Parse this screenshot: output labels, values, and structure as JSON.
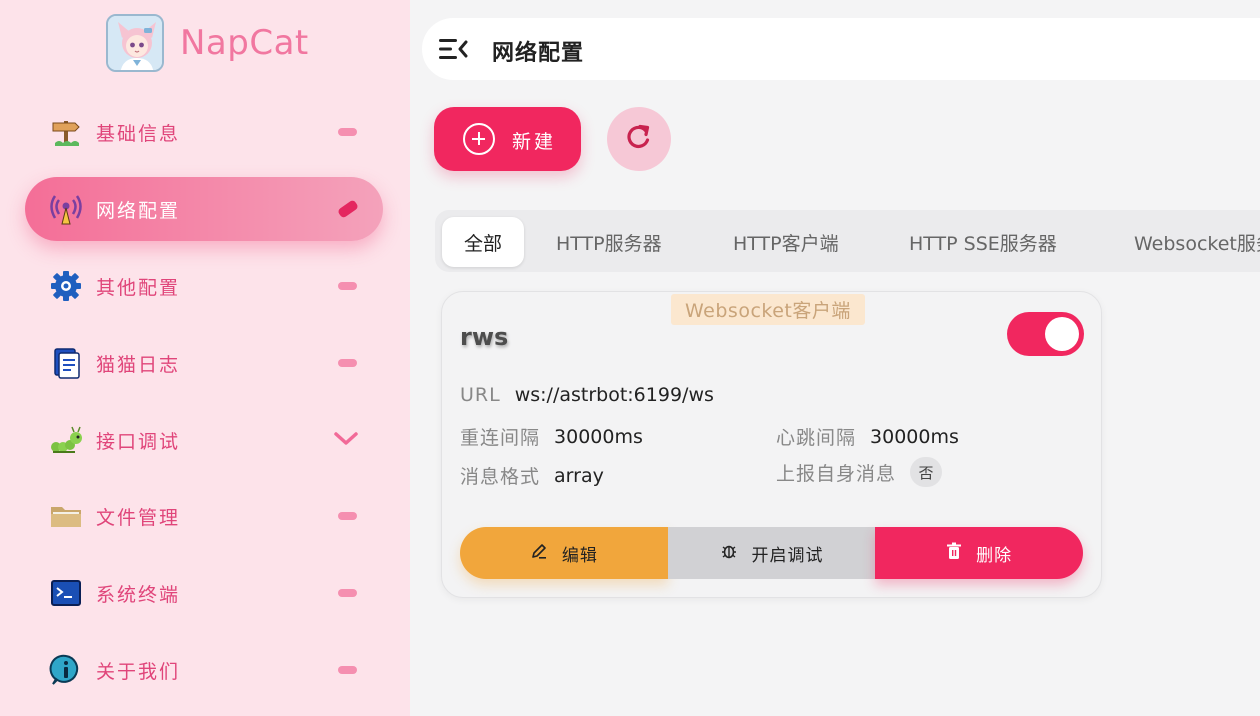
{
  "app": {
    "name": "NapCat"
  },
  "header": {
    "title": "网络配置"
  },
  "sidebar": {
    "items": [
      {
        "label": "基础信息",
        "icon": "signpost-icon",
        "active": false
      },
      {
        "label": "网络配置",
        "icon": "antenna-icon",
        "active": true
      },
      {
        "label": "其他配置",
        "icon": "gear-icon",
        "active": false
      },
      {
        "label": "猫猫日志",
        "icon": "document-icon",
        "active": false
      },
      {
        "label": "接口调试",
        "icon": "caterpillar-icon",
        "active": false,
        "expandable": true
      },
      {
        "label": "文件管理",
        "icon": "folder-icon",
        "active": false
      },
      {
        "label": "系统终端",
        "icon": "terminal-icon",
        "active": false
      },
      {
        "label": "关于我们",
        "icon": "info-icon",
        "active": false
      }
    ]
  },
  "toolbar": {
    "new_label": "新建",
    "refresh_icon": "refresh-icon"
  },
  "tabs": [
    {
      "label": "全部",
      "active": true
    },
    {
      "label": "HTTP服务器"
    },
    {
      "label": "HTTP客户端"
    },
    {
      "label": "HTTP SSE服务器"
    },
    {
      "label": "Websocket服务器"
    }
  ],
  "card": {
    "type": "Websocket客户端",
    "name": "rws",
    "enabled": true,
    "url_label": "URL",
    "url_value": "ws://astrbot:6199/ws",
    "reconnect_label": "重连间隔",
    "reconnect_value": "30000ms",
    "heartbeat_label": "心跳间隔",
    "heartbeat_value": "30000ms",
    "format_label": "消息格式",
    "format_value": "array",
    "report_self_label": "上报自身消息",
    "report_self_value": "否",
    "edit_label": "编辑",
    "debug_label": "开启调试",
    "delete_label": "删除"
  },
  "colors": {
    "accent": "#f1275f",
    "sidebar_bg": "#fde3ea",
    "brand": "#f177a0",
    "edit": "#f1a63c",
    "debug": "#d1d1d4"
  }
}
